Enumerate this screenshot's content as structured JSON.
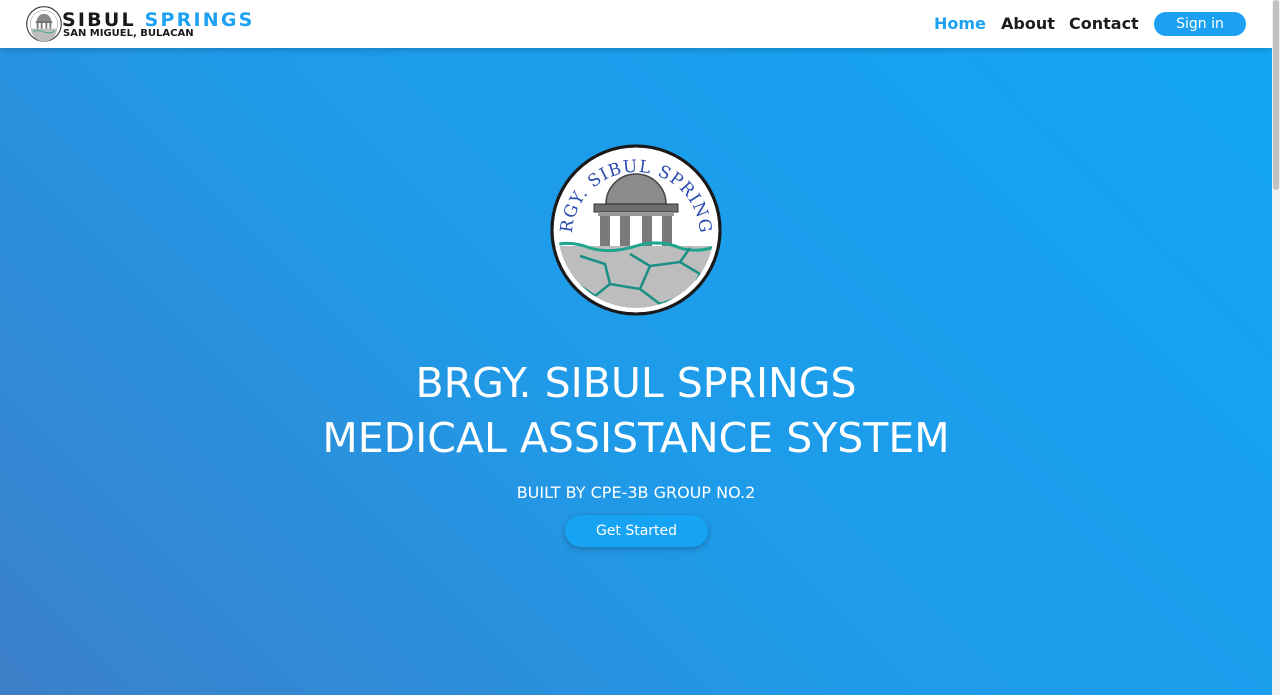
{
  "header": {
    "brand": {
      "name_part1": "SIBUL",
      "name_part2": "SPRINGS",
      "subtitle": "SAN MIGUEL, BULACAN"
    },
    "nav": {
      "home": "Home",
      "about": "About",
      "contact": "Contact",
      "signin": "Sign in"
    }
  },
  "hero": {
    "seal_text": "BRGY. SIBUL SPRINGS",
    "title_line1": "BRGY. SIBUL SPRINGS",
    "title_line2": "MEDICAL ASSISTANCE SYSTEM",
    "subtitle": "BUILT BY CPE-3B GROUP NO.2",
    "cta": "Get Started"
  },
  "colors": {
    "accent": "#1da1f2",
    "hero_start": "#3d7fc9",
    "hero_end": "#14a6f5"
  },
  "icons": {
    "logo": "barangay-seal-icon"
  }
}
